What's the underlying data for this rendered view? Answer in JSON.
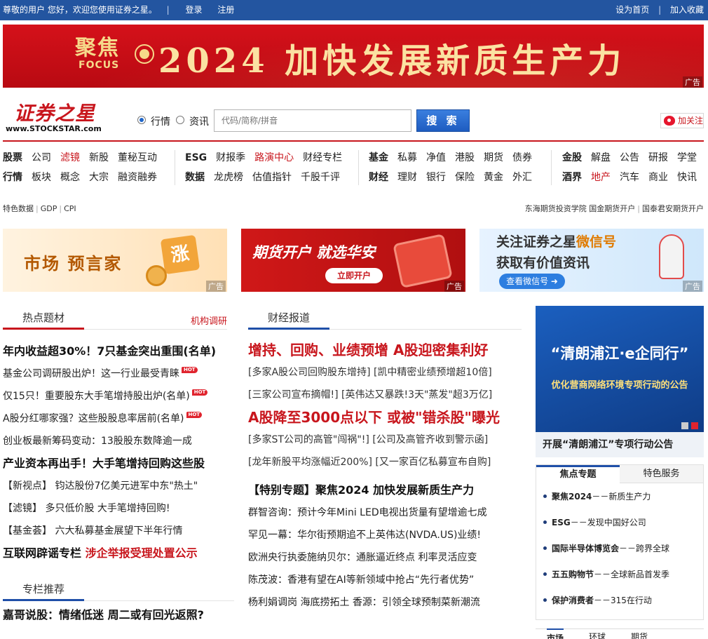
{
  "topbar": {
    "greeting": "尊敬的用户 您好，欢迎您使用证券之星。",
    "separator": "|",
    "login": "登录",
    "register": "注册",
    "set_home": "设为首页",
    "add_favorite": "加入收藏"
  },
  "banner": {
    "logo_cn": "聚焦",
    "logo_en": "FOCUS",
    "slogan": "2024 加快发展新质生产力",
    "ad_tag": "广告"
  },
  "header": {
    "logo_cn": "证券之星",
    "logo_en": "www.STOCKSTAR.com",
    "radio_quotes": "行情",
    "radio_news": "资讯",
    "search_placeholder": "代码/简称/拼音",
    "search_button": "搜 索",
    "follow_button": "加关注"
  },
  "nav": {
    "g1": {
      "row1": [
        "股票",
        "公司",
        "滤镜",
        "新股",
        "董秘互动"
      ],
      "row2": [
        "行情",
        "板块",
        "概念",
        "大宗",
        "融资融券"
      ]
    },
    "g2": {
      "row1": [
        "ESG",
        "财报季",
        "路演中心",
        "财经专栏"
      ],
      "row2": [
        "数据",
        "龙虎榜",
        "估值指针",
        "千股千评"
      ]
    },
    "g3": {
      "row1": [
        "基金",
        "私募",
        "净值",
        "港股",
        "期货",
        "债券"
      ],
      "row2": [
        "财经",
        "理财",
        "银行",
        "保险",
        "黄金",
        "外汇"
      ]
    },
    "g4": {
      "row1": [
        "金股",
        "解盘",
        "公告",
        "研报",
        "学堂"
      ],
      "row2": [
        "酒界",
        "地产",
        "汽车",
        "商业",
        "快讯"
      ]
    }
  },
  "small_links": {
    "left": [
      "特色数据",
      "GDP",
      "CPI"
    ],
    "right": [
      "东海期货投资学院",
      "国金期货开户",
      "国泰君安期货开户"
    ],
    "sep": "|"
  },
  "ads": {
    "ad1_text": "市场 预言家",
    "ad1_stamp": "涨",
    "ad2_text": "期货开户 就选华安",
    "ad2_button": "立即开户",
    "ad3_line1_a": "关注证券之星",
    "ad3_line1_b": "微信号",
    "ad3_line2": "获取有价值资讯",
    "ad3_button": "查看微信号 ➜",
    "tag": "广告"
  },
  "hot_topics": {
    "tab": "热点题材",
    "more": "机构调研",
    "items": [
      "年内收益超30%！7只基金突出重围(名单)",
      "基金公司调研股出炉！这一行业最受青睐",
      "仅15只！重要股东大手笔增持股出炉(名单)",
      "A股分红哪家强？这些股股息率居前(名单)",
      "创业板最新筹码变动：13股股东数降逾一成",
      "产业资本再出手！大手笔增持回购这些股",
      "【新视点】 钧达股份7亿美元进军中东\"热土\"",
      "【滤镜】 多只低价股 大手笔增持回购!",
      "【基金荟】 六大私募基金展望下半年行情",
      "互联网辟谣专栏"
    ],
    "item10_b": "涉企举报受理处置公示",
    "hot_badge": "HOT"
  },
  "columns": {
    "tab": "专栏推荐",
    "first": "嘉哥说股：情绪低迷 周二或有回光返照?"
  },
  "finance_news": {
    "tab": "财经报道",
    "headline1": "增持、回购、业绩预增 A股迎密集利好",
    "sub1a": "[多家A股公司回购股东增持]",
    "sub1b": "[凯中精密业绩预增超10倍]",
    "sub2a": "[三家公司宣布摘帽!]",
    "sub2b": "[英伟达又暴跌!3天\"蒸发\"超3万亿]",
    "headline2": "A股降至3000点以下 或被\"错杀股\"曝光",
    "sub3a": "[多家ST公司的高管\"闯祸\"!]",
    "sub3b": "[公司及高管齐收到警示函]",
    "sub4a": "[龙年新股平均涨幅近200%]",
    "sub4b": "[又一家百亿私募宣布自购]",
    "special": "【特别专题】聚焦2024 加快发展新质生产力",
    "items": [
      "群智咨询：预计今年Mini LED电视出货量有望增逾七成",
      "罕见一幕：华尔街预期追不上英伟达(NVDA.US)业绩!",
      "欧洲央行执委施纳贝尔：通胀逼近终点 利率灵活应变",
      "陈茂波：香港有望在AI等新领域中抢占“先行者优势”",
      "杨利娟调岗 海底捞拓土 香源：引领全球预制菜新潮流"
    ]
  },
  "promo": {
    "title": "“清朗浦江·e企同行”",
    "subtitle": "优化营商网络环境专项行动的公告",
    "caption": "开展“清朗浦江”专项行动公告"
  },
  "focus_box": {
    "tab1": "焦点专题",
    "tab2": "特色服务",
    "items": [
      {
        "a": "聚焦2024",
        "b": "－－新质生产力"
      },
      {
        "a": "ESG",
        "b": "－－发现中国好公司"
      },
      {
        "a": "国际半导体博览会",
        "b": "－－跨界全球"
      },
      {
        "a": "五五购物节",
        "b": "－－全球新品首发季"
      },
      {
        "a": "保护消费者",
        "b": "－－315在行动"
      }
    ]
  },
  "bottom_tabs": [
    "市场",
    "环球",
    "期货"
  ],
  "colors": {
    "brand_blue": "#2355a0",
    "brand_red": "#c8161d"
  }
}
